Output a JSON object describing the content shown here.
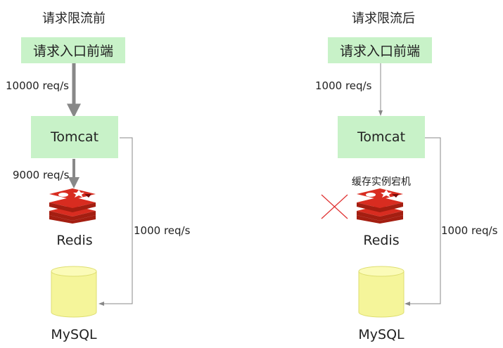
{
  "left": {
    "title": "请求限流前",
    "frontend": "请求入口前端",
    "rate_to_tomcat": "10000 req/s",
    "tomcat": "Tomcat",
    "rate_to_redis": "9000 req/s",
    "redis": "Redis",
    "rate_to_mysql": "1000 req/s",
    "mysql": "MySQL"
  },
  "right": {
    "title": "请求限流后",
    "frontend": "请求入口前端",
    "rate_to_tomcat": "1000 req/s",
    "tomcat": "Tomcat",
    "cache_down_note": "缓存实例宕机",
    "redis": "Redis",
    "rate_to_mysql": "1000 req/s",
    "mysql": "MySQL"
  },
  "colors": {
    "box_fill": "#c8f2c8",
    "redis_red": "#d82c20",
    "mysql_fill": "#f5f59a",
    "arrow_gray": "#888888",
    "cross_red": "#e03030"
  },
  "icons": [
    "redis-logo-icon",
    "mysql-cylinder-icon",
    "red-cross-icon"
  ]
}
